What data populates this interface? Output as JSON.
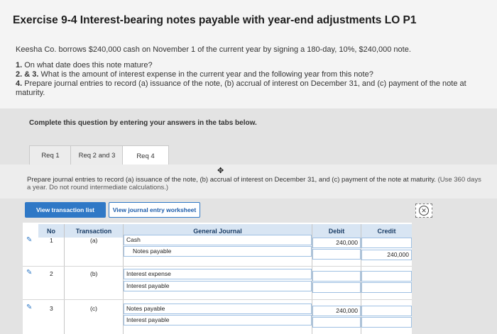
{
  "title": "Exercise 9-4 Interest-bearing notes payable with year-end adjustments LO P1",
  "intro": "Keesha Co. borrows $240,000 cash on November 1 of the current year by signing a 180-day, 10%, $240,000 note.",
  "questions": [
    {
      "num": "1.",
      "text": " On what date does this note mature?"
    },
    {
      "num": "2. & 3.",
      "text": " What is the amount of interest expense in the current year and the following year from this note?"
    },
    {
      "num": "4.",
      "text": " Prepare journal entries to record (a) issuance of the note, (b) accrual of interest on December 31, and (c) payment of the note at maturity."
    }
  ],
  "panel_heading": "Complete this question by entering your answers in the tabs below.",
  "tabs": [
    {
      "label": "Req 1"
    },
    {
      "label": "Req 2 and 3"
    },
    {
      "label": "Req 4"
    }
  ],
  "instructions": "Prepare journal entries to record (a) issuance of the note, (b) accrual of interest on December 31, and (c) payment of the note at maturity.",
  "instructions_note": "(Use 360 days a year. Do not round intermediate calculations.)",
  "buttons": {
    "view_transaction_list": "View transaction list",
    "view_journal_worksheet": "View journal entry worksheet"
  },
  "table": {
    "headers": {
      "no": "No",
      "transaction": "Transaction",
      "general_journal": "General Journal",
      "debit": "Debit",
      "credit": "Credit"
    },
    "rows": [
      {
        "no": "1",
        "transaction": "(a)",
        "debit_account": "Cash",
        "credit_account": "Notes payable",
        "debit": "240,000",
        "credit": "240,000"
      },
      {
        "no": "2",
        "transaction": "(b)",
        "debit_account": "Interest expense",
        "credit_account": "Interest payable",
        "debit": "",
        "credit": ""
      },
      {
        "no": "3",
        "transaction": "(c)",
        "debit_account": "Notes payable",
        "credit_account": "Interest payable",
        "debit": "240,000",
        "credit": ""
      }
    ]
  },
  "icons": {
    "edit": "pencil-icon",
    "close": "close-circle-icon"
  },
  "colors": {
    "accent": "#2f78c6",
    "header_bg": "#d8e5f3"
  }
}
